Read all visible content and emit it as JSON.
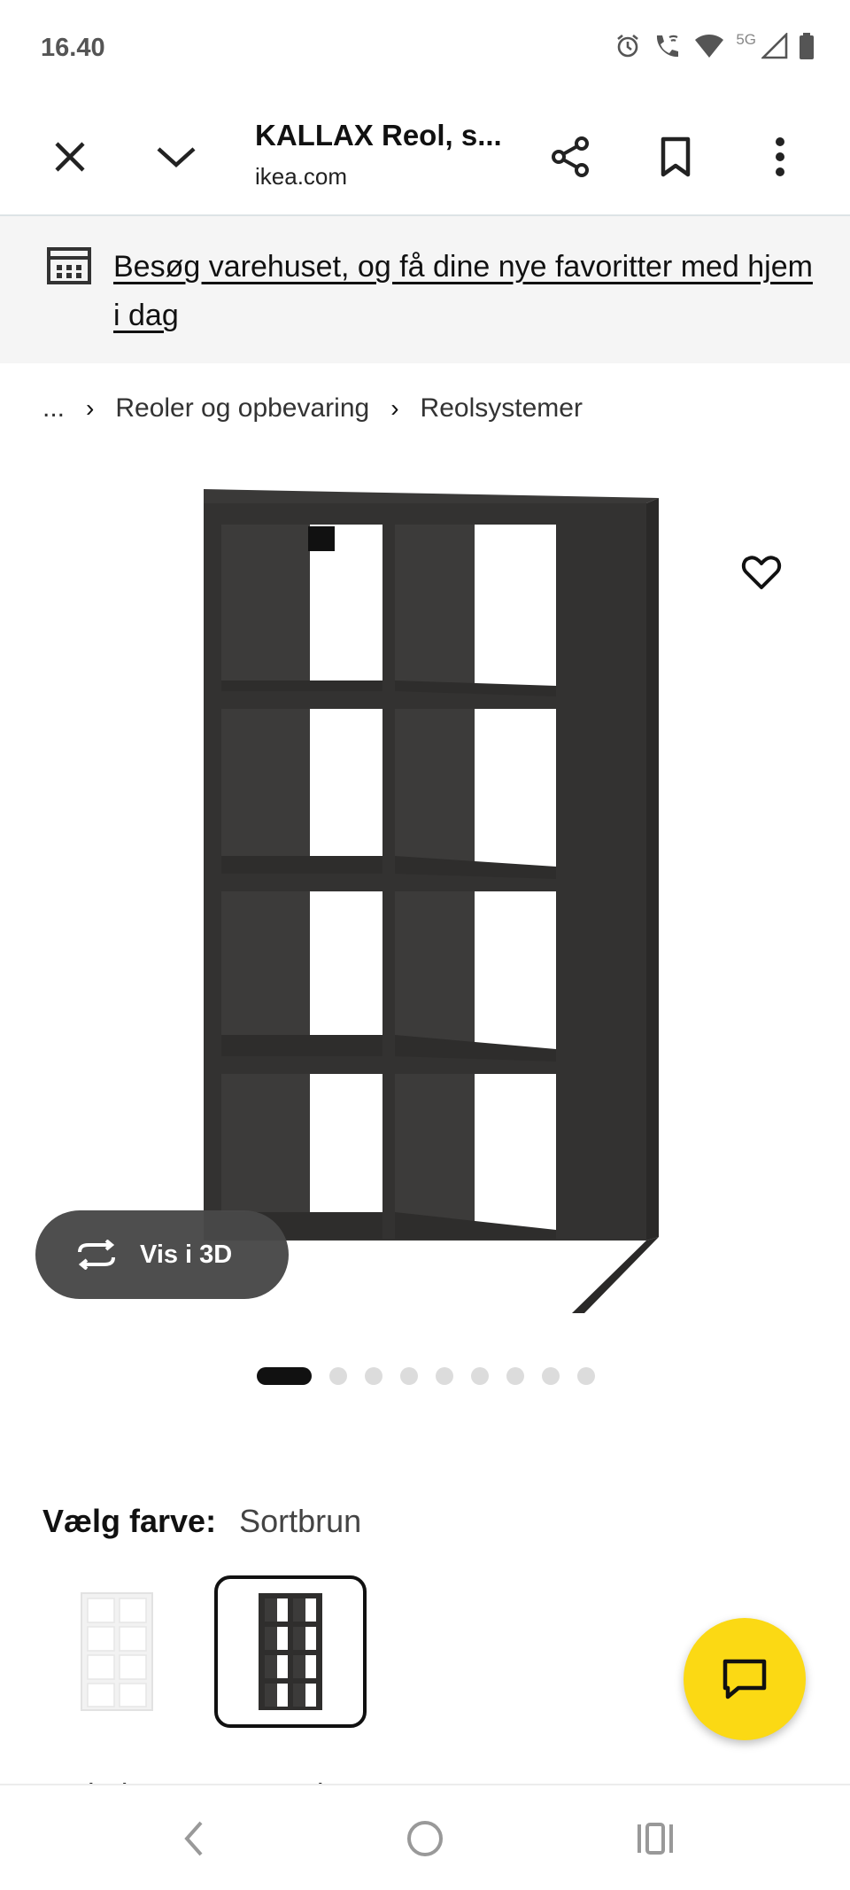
{
  "status_bar": {
    "time": "16.40",
    "network": "5G",
    "icons": [
      "alarm-icon",
      "wifi-call-icon",
      "wifi-icon",
      "signal-icon",
      "battery-icon"
    ]
  },
  "toolbar": {
    "title": "KALLAX Reol, s...",
    "url": "ikea.com",
    "icons": [
      "close-icon",
      "chevron-down-icon",
      "share-icon",
      "bookmark-icon",
      "more-vert-icon"
    ]
  },
  "banner": {
    "text": "Besøg varehuset, og få dine nye favoritter med hjem i dag",
    "icon": "store-icon"
  },
  "breadcrumb": {
    "items": [
      "...",
      "Reoler og opbevaring",
      "Reolsystemer"
    ]
  },
  "product": {
    "view_3d_label": "Vis i 3D",
    "image_count": 9,
    "active_image": 1
  },
  "color": {
    "label": "Vælg farve:",
    "value": "Sortbrun",
    "swatches": [
      "white",
      "Sortbrun"
    ],
    "selected_swatch": 2
  },
  "see_all": "Se hele KALLAX serien",
  "colors": {
    "brand_yellow": "#fbd914",
    "shelf_dark": "#333231",
    "pill_bg": "#484848"
  }
}
